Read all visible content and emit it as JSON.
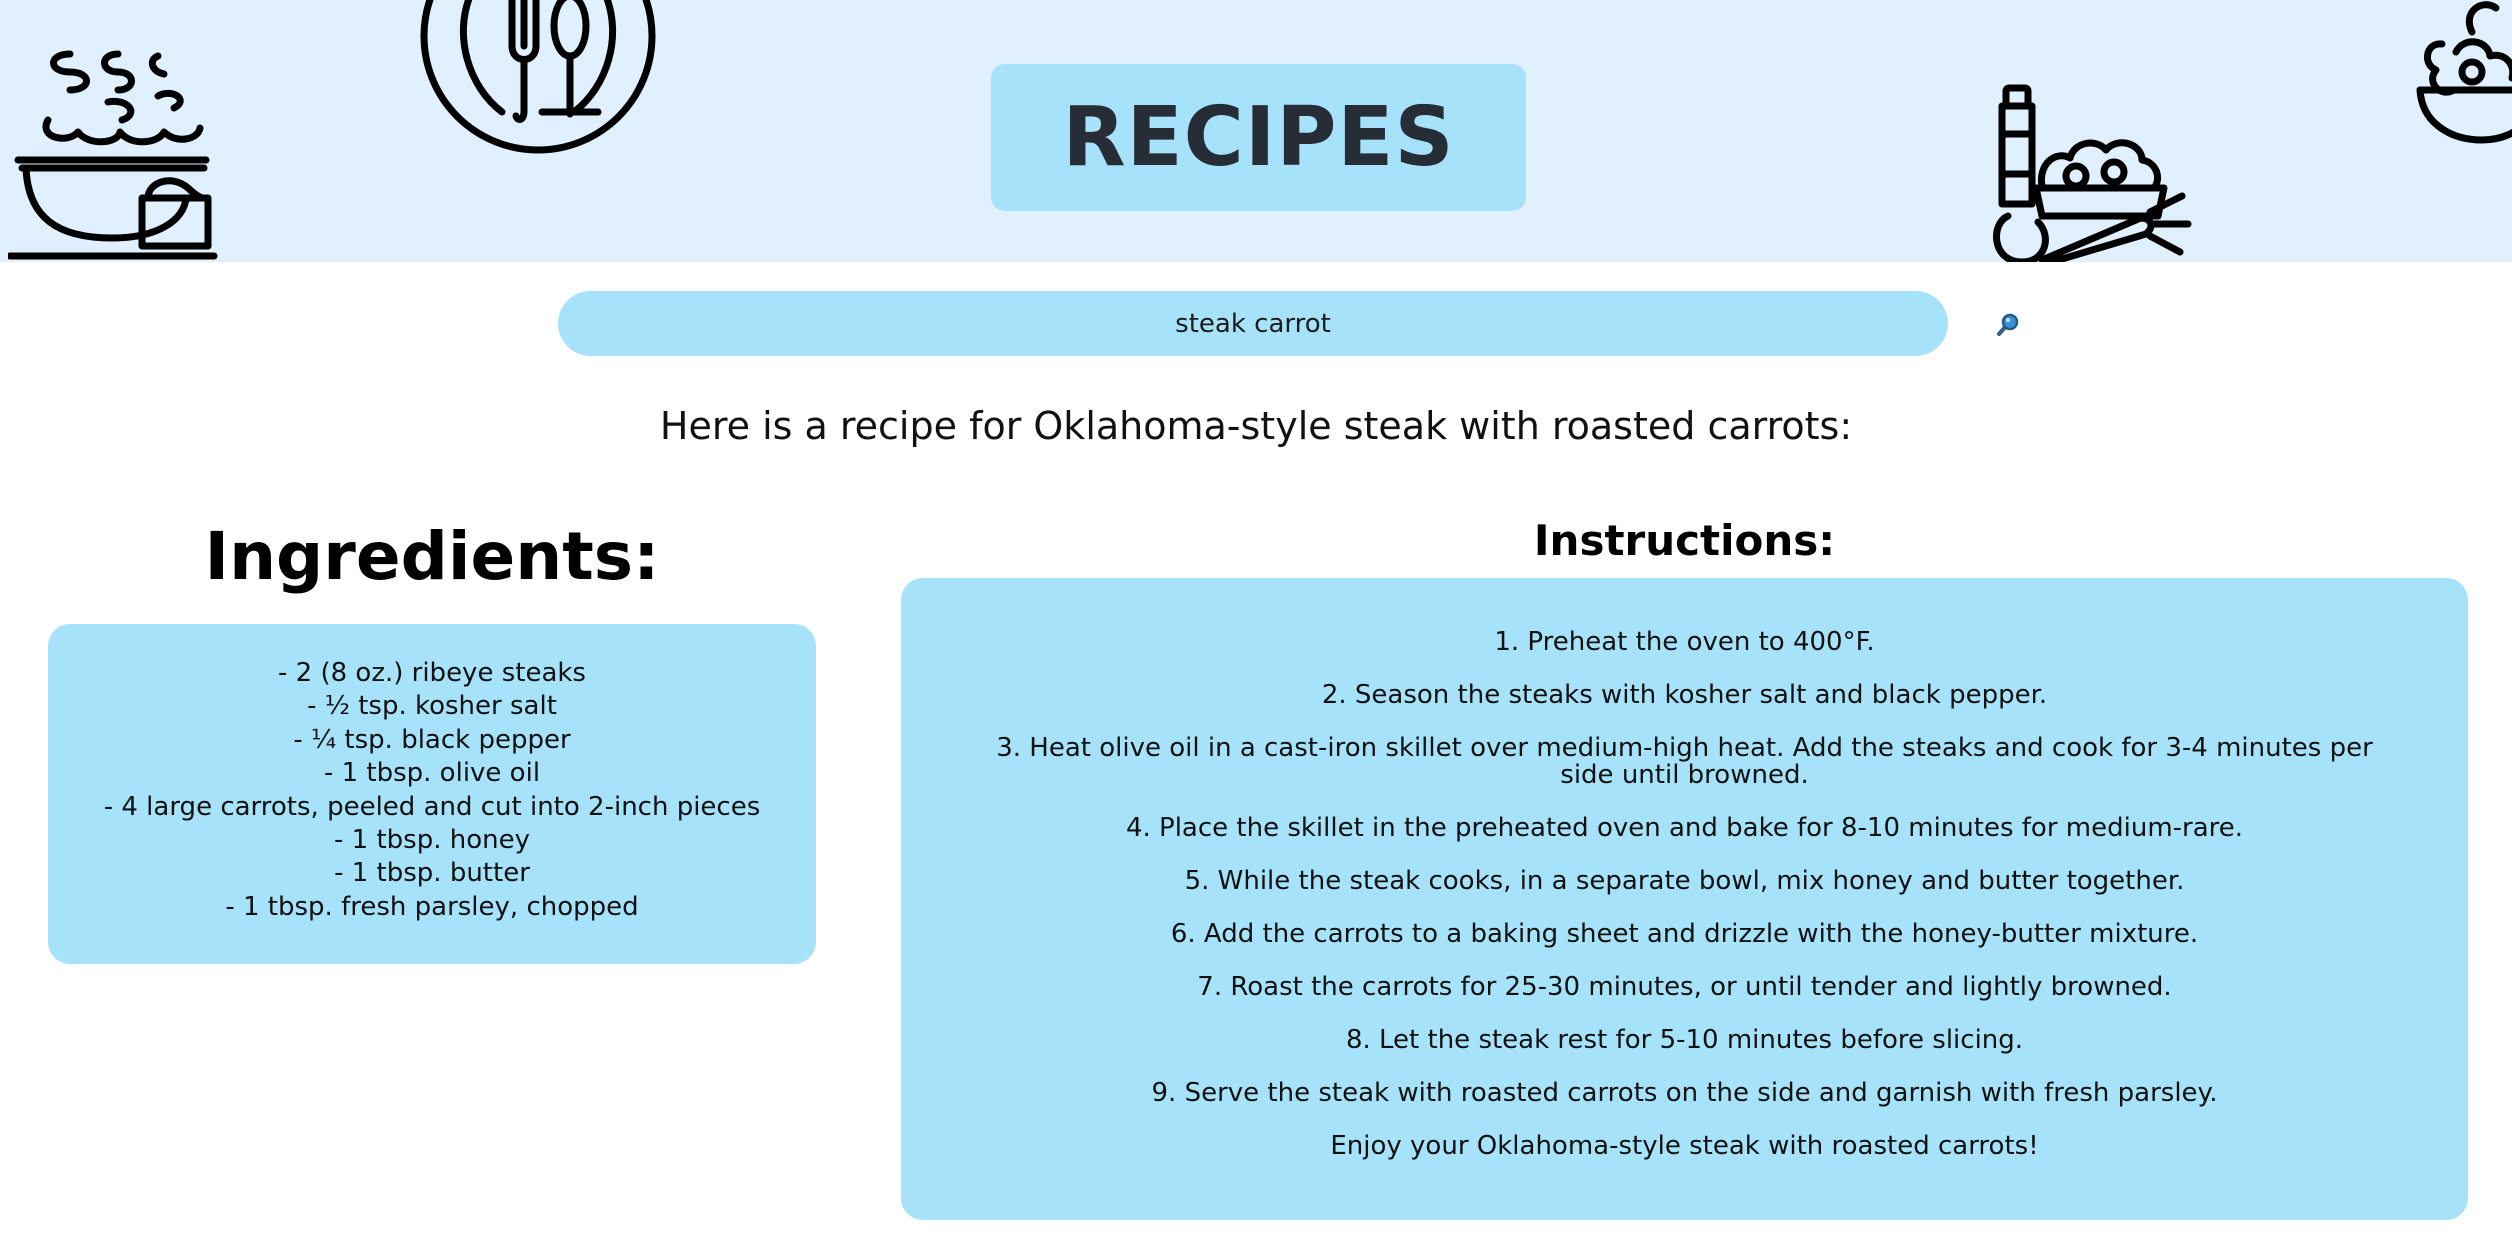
{
  "header": {
    "title": "RECIPES"
  },
  "search": {
    "value": "steak carrot",
    "button_icon": "magnifier-icon"
  },
  "recipe": {
    "intro": "Here is a recipe for Oklahoma-style steak with roasted carrots:",
    "ingredients_heading": "Ingredients:",
    "ingredients": [
      "- 2 (8 oz.) ribeye steaks",
      "- ½ tsp. kosher salt",
      "- ¼ tsp. black pepper",
      "- 1 tbsp. olive oil",
      "- 4 large carrots, peeled and cut into 2-inch pieces",
      "- 1 tbsp. honey",
      "- 1 tbsp. butter",
      "- 1 tbsp. fresh parsley, chopped"
    ],
    "instructions_heading": "Instructions:",
    "instructions": [
      "1. Preheat the oven to 400°F.",
      "2. Season the steaks with kosher salt and black pepper.",
      "3. Heat olive oil in a cast-iron skillet over medium-high heat. Add the steaks and cook for 3-4 minutes per side until browned.",
      "4. Place the skillet in the preheated oven and bake for 8-10 minutes for medium-rare.",
      "5. While the steak cooks, in a separate bowl, mix honey and butter together.",
      "6. Add the carrots to a baking sheet and drizzle with the honey-butter mixture.",
      "7. Roast the carrots for 25-30 minutes, or until tender and lightly browned.",
      "8. Let the steak rest for 5-10 minutes before slicing.",
      "9. Serve the steak with roasted carrots on the side and garnish with fresh parsley.",
      "Enjoy your Oklahoma-style steak with roasted carrots!"
    ]
  },
  "decorations": [
    "steaming-pot-icon",
    "plate-fork-spoon-icon",
    "groceries-bag-icon",
    "salad-bowl-icon"
  ],
  "colors": {
    "header_bg": "#e0f0fe",
    "accent": "#a6e3fa",
    "title_text": "#262d36"
  }
}
